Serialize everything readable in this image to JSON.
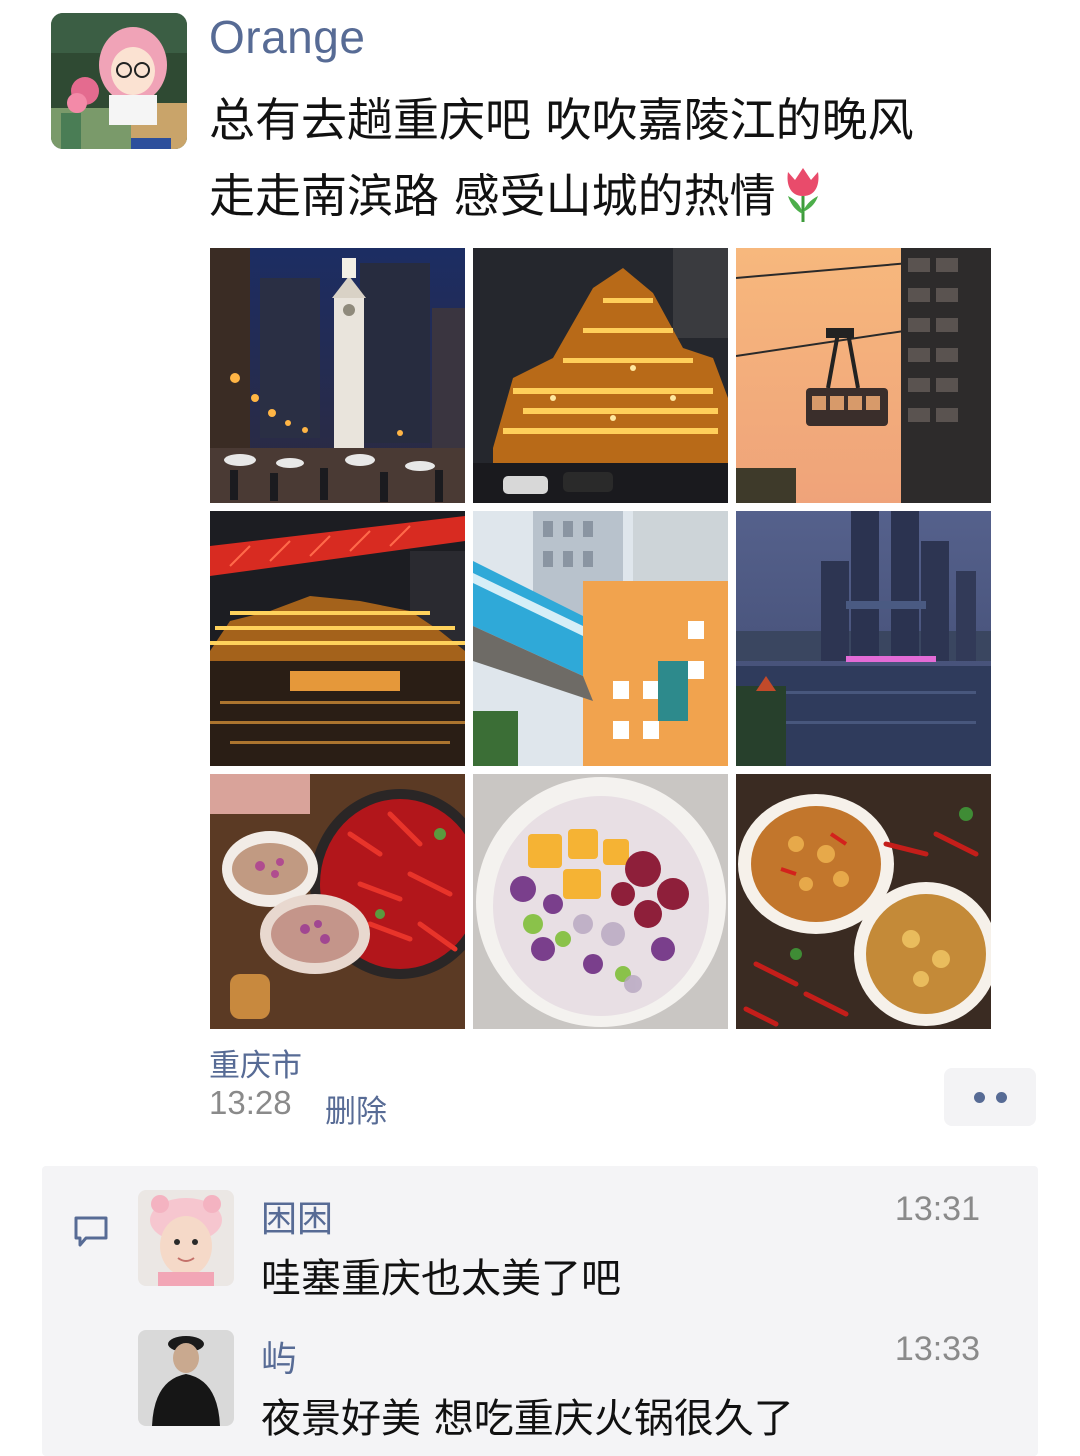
{
  "post": {
    "author": "Orange",
    "text_lines": [
      "总有去趟重庆吧 吹吹嘉陵江的晚风",
      "走走南滨路 感受山城的热情"
    ],
    "emoji": "tulip-emoji",
    "location": "重庆市",
    "time": "13:28",
    "delete_label": "删除",
    "photos": [
      "liberation-monument-night-photo",
      "hongyadong-night-photo",
      "cable-car-sunset-photo",
      "bridge-hongyadong-river-photo",
      "monorail-through-building-photo",
      "raffles-city-river-view-photo",
      "hotpot-and-chili-photo",
      "mango-fruit-bowl-photo",
      "spicy-noodle-plates-photo"
    ]
  },
  "comments": [
    {
      "name": "困困",
      "time": "13:31",
      "text": "哇塞重庆也太美了吧"
    },
    {
      "name": "屿",
      "time": "13:33",
      "text": "夜景好美 想吃重庆火锅很久了"
    }
  ],
  "colors": {
    "link": "#576b95",
    "comment_bg": "#f4f4f6",
    "time_gray": "#8a8a8a"
  }
}
